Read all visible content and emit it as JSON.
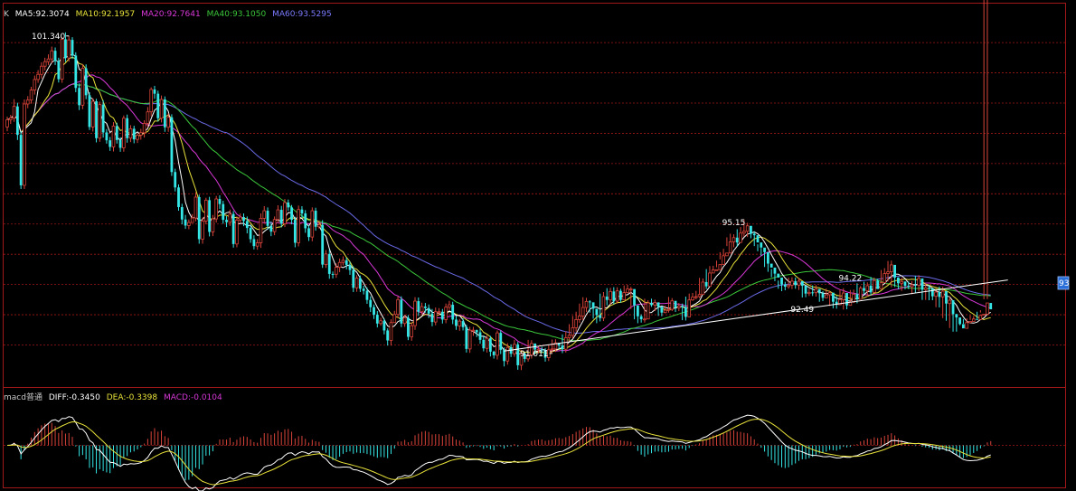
{
  "legend": {
    "k_label": "K",
    "ma5": "MA5:92.3074",
    "ma10": "MA10:92.1957",
    "ma20": "MA20:92.7641",
    "ma40": "MA40:93.1050",
    "ma60": "MA60:93.5295"
  },
  "macd_legend": {
    "name": "macd普通",
    "diff": "DIFF:-0.3450",
    "dea": "DEA:-0.3398",
    "macd": "MACD:-0.0104"
  },
  "colors": {
    "background": "#000000",
    "up_candle": "#d9443a",
    "down_candle": "#35e6e6",
    "ma5": "#ffffff",
    "ma10": "#e8e23a",
    "ma20": "#d838d8",
    "ma40": "#3ac63a",
    "ma60": "#6a6ae8",
    "grid": "#a01818",
    "trendline": "#ffffff",
    "price_tag": "#2a6fd8"
  },
  "chart_data": {
    "type": "candlestick",
    "grid": "horizontal dashed",
    "price_tag": "93",
    "annotations": [
      {
        "label": "101.340",
        "kind": "high",
        "bar": 18
      },
      {
        "label": "95.15",
        "kind": "high",
        "bar": 212
      },
      {
        "label": "94.22",
        "kind": "high",
        "bar": 246
      },
      {
        "label": "92.49",
        "kind": "low",
        "bar": 232
      },
      {
        "label": "91.011",
        "kind": "low",
        "bar": 159
      }
    ],
    "trendline": {
      "from_bar": 145,
      "from_value": 90.8,
      "to_bar": 292,
      "to_value": 93.15
    },
    "closes": [
      98.45,
      98.51,
      98.89,
      97.95,
      96.28,
      98.97,
      99.1,
      99.43,
      99.78,
      99.95,
      100.22,
      100.37,
      100.46,
      100.73,
      100.39,
      99.79,
      101.11,
      100.49,
      101.09,
      100.57,
      99.5,
      98.93,
      100.15,
      99.26,
      98.21,
      99.06,
      97.84,
      98.95,
      98.03,
      97.77,
      97.55,
      98.24,
      97.78,
      97.52,
      98.5,
      97.84,
      98.15,
      97.8,
      97.94,
      98.02,
      98.33,
      98.71,
      99.45,
      99.31,
      98.5,
      99.12,
      98.2,
      98.53,
      96.72,
      96.21,
      95.56,
      95.15,
      94.95,
      95.05,
      95.2,
      95.89,
      94.5,
      95.1,
      95.79,
      94.74,
      95.17,
      95.83,
      95.66,
      95.14,
      95.06,
      95.33,
      94.34,
      95.13,
      95.23,
      95.1,
      94.87,
      94.5,
      94.27,
      94.38,
      95.19,
      95.44,
      94.94,
      94.75,
      95.15,
      95.47,
      95.01,
      95.71,
      95.55,
      95.14,
      94.38,
      95.48,
      95.35,
      94.86,
      94.57,
      95.44,
      94.91,
      94.97,
      93.66,
      94.01,
      93.35,
      93.34,
      93.57,
      93.73,
      93.8,
      93.65,
      93.48,
      92.89,
      93.21,
      92.86,
      92.79,
      92.49,
      92.25,
      92.0,
      91.71,
      91.8,
      91.48,
      91.15,
      91.74,
      92.01,
      92.5,
      91.71,
      91.9,
      91.27,
      91.64,
      92.45,
      92.1,
      92.27,
      92.22,
      92.04,
      91.76,
      92.1,
      92.1,
      91.84,
      92.25,
      92.33,
      91.84,
      91.63,
      91.79,
      91.59,
      90.87,
      91.49,
      91.49,
      91.42,
      91.17,
      90.89,
      91.22,
      90.78,
      90.66,
      91.4,
      90.84,
      90.47,
      90.92,
      90.71,
      91.02,
      90.33,
      90.72,
      90.54,
      90.67,
      91.05,
      90.85,
      90.86,
      90.83,
      90.58,
      90.84,
      90.87,
      91.07,
      90.98,
      90.86,
      91.24,
      91.32,
      91.57,
      91.84,
      91.96,
      92.24,
      92.44,
      92.41,
      92.2,
      91.99,
      91.89,
      92.6,
      92.49,
      92.77,
      92.45,
      92.79,
      92.49,
      92.73,
      92.85,
      92.85,
      92.31,
      91.95,
      91.85,
      91.86,
      92.39,
      92.32,
      92.41,
      92.26,
      92.07,
      92.15,
      92.18,
      92.46,
      92.23,
      92.28,
      92.25,
      91.93,
      92.49,
      92.58,
      92.6,
      92.67,
      93.08,
      92.94,
      93.38,
      93.48,
      93.49,
      93.66,
      93.95,
      94.04,
      94.41,
      94.55,
      94.39,
      94.7,
      94.76,
      94.94,
      94.68,
      94.63,
      94.39,
      94.22,
      94.07,
      93.69,
      93.56,
      93.36,
      93.23,
      93.0,
      92.93,
      92.98,
      93.11,
      92.98,
      93.11,
      92.96,
      92.7,
      92.74,
      92.73,
      92.85,
      92.71,
      92.56,
      92.66,
      92.73,
      92.43,
      92.33,
      92.5,
      92.72,
      92.31,
      92.42,
      92.68,
      92.51,
      92.88,
      92.79,
      92.96,
      92.74,
      93.13,
      92.85,
      93.06,
      93.36,
      93.42,
      93.65,
      93.23,
      93.04,
      93.1,
      92.96,
      92.93,
      92.99,
      92.97,
      93.2,
      92.83,
      92.89,
      92.87,
      92.61,
      92.75,
      92.59,
      92.78,
      92.37,
      92.48,
      92.02,
      91.91,
      91.69,
      91.55,
      91.74,
      91.78,
      91.86,
      91.84,
      91.98,
      92.02,
      92.39,
      92.18
    ],
    "opens": [
      98.21,
      98.45,
      98.51,
      98.89,
      97.95,
      96.28,
      98.97,
      99.1,
      99.43,
      99.78,
      99.95,
      100.22,
      100.37,
      100.46,
      100.73,
      100.39,
      99.79,
      101.11,
      100.49,
      101.09,
      100.57,
      99.5,
      98.93,
      100.15,
      99.26,
      98.21,
      99.06,
      97.84,
      98.95,
      98.03,
      97.77,
      97.55,
      98.24,
      97.78,
      97.52,
      98.5,
      97.84,
      98.15,
      97.8,
      97.94,
      98.02,
      98.33,
      98.71,
      99.45,
      99.31,
      98.5,
      99.12,
      98.2,
      98.53,
      96.72,
      96.21,
      95.56,
      95.15,
      94.95,
      95.05,
      95.2,
      95.89,
      94.5,
      95.1,
      95.79,
      94.74,
      95.17,
      95.83,
      95.66,
      95.14,
      95.06,
      95.33,
      94.34,
      95.13,
      95.23,
      95.1,
      94.87,
      94.5,
      94.27,
      94.38,
      95.19,
      95.44,
      94.94,
      94.75,
      95.15,
      95.47,
      95.01,
      95.71,
      95.55,
      95.14,
      94.38,
      95.48,
      95.35,
      94.86,
      94.57,
      95.44,
      94.91,
      94.97,
      93.66,
      94.01,
      93.35,
      93.34,
      93.57,
      93.73,
      93.8,
      93.65,
      93.48,
      92.89,
      93.21,
      92.86,
      92.79,
      92.49,
      92.25,
      92.0,
      91.71,
      91.8,
      91.48,
      91.15,
      91.74,
      92.01,
      92.5,
      91.71,
      91.9,
      91.27,
      91.64,
      92.45,
      92.1,
      92.27,
      92.22,
      92.04,
      91.76,
      92.1,
      92.1,
      91.84,
      92.25,
      92.33,
      91.84,
      91.63,
      91.79,
      91.59,
      90.87,
      91.49,
      91.49,
      91.42,
      91.17,
      90.89,
      91.22,
      90.78,
      90.66,
      91.4,
      90.84,
      90.47,
      90.92,
      90.71,
      91.02,
      90.33,
      90.72,
      90.54,
      90.67,
      91.05,
      90.85,
      90.86,
      90.83,
      90.58,
      90.84,
      90.87,
      91.07,
      90.98,
      90.86,
      91.24,
      91.32,
      91.57,
      91.84,
      91.96,
      92.24,
      92.44,
      92.41,
      92.2,
      91.99,
      91.89,
      92.6,
      92.49,
      92.77,
      92.45,
      92.79,
      92.49,
      92.73,
      92.85,
      92.85,
      92.31,
      91.95,
      91.85,
      91.86,
      92.39,
      92.32,
      92.41,
      92.26,
      92.07,
      92.15,
      92.18,
      92.46,
      92.23,
      92.28,
      92.25,
      91.93,
      92.49,
      92.58,
      92.6,
      92.67,
      93.08,
      92.94,
      93.38,
      93.48,
      93.49,
      93.66,
      93.95,
      94.04,
      94.41,
      94.55,
      94.39,
      94.7,
      94.76,
      94.94,
      94.68,
      94.63,
      94.39,
      94.22,
      94.07,
      93.69,
      93.56,
      93.36,
      93.23,
      93.0,
      92.93,
      92.98,
      93.11,
      92.98,
      93.11,
      92.96,
      92.7,
      92.74,
      92.73,
      92.85,
      92.71,
      92.56,
      92.66,
      92.73,
      92.43,
      92.33,
      92.5,
      92.72,
      92.31,
      92.42,
      92.68,
      92.51,
      92.88,
      92.79,
      92.96,
      92.74,
      93.13,
      92.85,
      93.06,
      93.36,
      93.42,
      93.65,
      93.23,
      93.04,
      93.1,
      92.96,
      92.93,
      92.99,
      92.97,
      93.2,
      92.83,
      92.89,
      92.87,
      92.61,
      92.75,
      92.59,
      92.78,
      92.37,
      92.48,
      92.02,
      91.91,
      91.69,
      91.55,
      91.74,
      91.78,
      91.86,
      91.84,
      91.98,
      92.02,
      92.39
    ],
    "highs": [
      98.55,
      98.61,
      99.13,
      99.01,
      98.07,
      99.12,
      99.23,
      99.54,
      99.91,
      100.09,
      100.35,
      100.5,
      100.61,
      100.87,
      100.84,
      100.5,
      101.18,
      101.34,
      101.22,
      101.18,
      100.68,
      99.65,
      100.29,
      100.28,
      99.36,
      99.16,
      99.14,
      99.05,
      99.1,
      98.14,
      97.88,
      98.37,
      98.35,
      97.87,
      98.59,
      98.62,
      98.27,
      98.25,
      97.99,
      98.15,
      98.43,
      98.87,
      99.52,
      99.57,
      99.41,
      99.25,
      99.22,
      98.66,
      98.63,
      96.83,
      96.31,
      95.67,
      95.3,
      95.15,
      95.33,
      96.05,
      95.97,
      95.22,
      95.87,
      95.9,
      95.3,
      95.93,
      95.95,
      95.77,
      95.26,
      95.48,
      95.43,
      95.25,
      95.35,
      95.35,
      95.25,
      94.98,
      94.63,
      94.5,
      95.35,
      95.59,
      95.55,
      95.09,
      95.25,
      95.62,
      95.6,
      95.83,
      95.81,
      95.63,
      95.24,
      95.61,
      95.59,
      95.46,
      94.97,
      95.55,
      95.54,
      95.12,
      95.13,
      94.14,
      94.15,
      93.43,
      93.7,
      93.86,
      93.93,
      93.89,
      93.75,
      93.6,
      93.31,
      93.3,
      92.96,
      92.9,
      92.61,
      92.34,
      92.12,
      91.9,
      91.87,
      91.55,
      91.85,
      92.13,
      92.61,
      92.61,
      92.0,
      91.99,
      91.75,
      92.58,
      92.57,
      92.4,
      92.39,
      92.34,
      92.19,
      92.24,
      92.22,
      92.19,
      92.37,
      92.46,
      92.43,
      91.97,
      91.86,
      91.88,
      91.67,
      91.6,
      91.6,
      91.51,
      91.54,
      91.29,
      91.32,
      91.3,
      90.81,
      91.48,
      91.48,
      90.92,
      91.06,
      91.02,
      91.17,
      91.1,
      90.84,
      90.75,
      91.17,
      91.16,
      90.96,
      90.96,
      90.94,
      90.9,
      91.0,
      91.18,
      91.19,
      91.04,
      91.35,
      91.45,
      91.69,
      91.96,
      92.1,
      92.37,
      92.58,
      92.56,
      92.48,
      92.33,
      92.05,
      92.7,
      92.75,
      92.88,
      92.89,
      92.91,
      92.91,
      92.86,
      92.97,
      92.99,
      92.92,
      92.4,
      92.01,
      92.01,
      92.53,
      92.48,
      92.53,
      92.5,
      92.38,
      92.28,
      92.3,
      92.59,
      92.55,
      92.41,
      92.39,
      92.37,
      92.6,
      92.7,
      92.72,
      92.79,
      93.22,
      93.2,
      93.51,
      93.61,
      93.62,
      93.79,
      94.07,
      94.18,
      94.56,
      94.68,
      94.66,
      94.83,
      94.9,
      95.15,
      95.04,
      94.77,
      94.76,
      94.33,
      94.21,
      94.16,
      93.82,
      93.51,
      93.46,
      93.13,
      93.05,
      93.09,
      93.23,
      93.24,
      93.23,
      93.22,
      92.97,
      92.85,
      92.86,
      92.97,
      92.98,
      92.81,
      92.78,
      92.87,
      92.8,
      92.52,
      92.62,
      92.84,
      92.88,
      92.55,
      92.82,
      92.83,
      93.04,
      92.95,
      93.09,
      93.07,
      93.25,
      93.23,
      93.19,
      93.48,
      93.54,
      93.78,
      93.79,
      93.35,
      93.24,
      93.23,
      93.06,
      93.1,
      93.11,
      93.29,
      93.31,
      92.99,
      93.04,
      92.99,
      92.88,
      92.88,
      92.93,
      92.93,
      92.62,
      92.61,
      92.16,
      92.03,
      91.86,
      91.86,
      91.88,
      91.98,
      91.96,
      92.1,
      92.15,
      92.51,
      92.52
    ],
    "lows": [
      98.07,
      98.31,
      98.38,
      97.78,
      96.16,
      96.16,
      98.83,
      98.98,
      99.28,
      99.67,
      99.81,
      100.08,
      100.26,
      100.32,
      100.26,
      99.68,
      99.67,
      100.36,
      100.37,
      100.46,
      99.36,
      98.77,
      98.8,
      99.13,
      98.11,
      98.06,
      97.7,
      97.72,
      97.86,
      97.66,
      97.42,
      97.4,
      97.66,
      97.39,
      97.39,
      97.69,
      97.71,
      97.67,
      97.68,
      97.79,
      97.86,
      98.21,
      98.56,
      99.14,
      98.39,
      98.36,
      98.05,
      98.05,
      96.59,
      96.08,
      95.44,
      94.99,
      94.84,
      94.83,
      95.07,
      95.09,
      94.35,
      94.35,
      94.99,
      94.59,
      94.6,
      95.05,
      95.5,
      95.01,
      94.9,
      94.94,
      94.22,
      94.23,
      95.04,
      94.93,
      94.69,
      94.38,
      94.16,
      94.15,
      94.21,
      95.03,
      94.81,
      94.6,
      94.63,
      95.04,
      94.89,
      94.9,
      95.44,
      94.99,
      94.23,
      94.26,
      95.21,
      94.71,
      94.44,
      94.43,
      94.78,
      94.85,
      93.55,
      93.55,
      93.19,
      93.2,
      93.22,
      93.41,
      93.63,
      93.5,
      93.32,
      92.75,
      92.76,
      92.75,
      92.67,
      92.36,
      92.09,
      91.86,
      91.58,
      91.64,
      91.35,
      90.98,
      90.98,
      91.9,
      91.89,
      91.59,
      91.6,
      91.16,
      91.14,
      91.5,
      91.96,
      92.0,
      92.07,
      91.89,
      91.62,
      91.65,
      91.97,
      91.71,
      91.72,
      92.16,
      91.69,
      91.5,
      91.47,
      91.48,
      90.75,
      90.74,
      91.3,
      91.26,
      91.04,
      90.79,
      90.75,
      90.62,
      90.55,
      90.52,
      90.7,
      90.29,
      90.35,
      90.6,
      90.61,
      90.18,
      90.17,
      90.43,
      90.45,
      90.55,
      90.69,
      90.72,
      90.74,
      90.45,
      90.47,
      90.72,
      90.77,
      90.86,
      90.73,
      90.75,
      91.12,
      91.22,
      91.44,
      91.73,
      91.82,
      92.09,
      92.07,
      91.87,
      91.72,
      91.78,
      91.79,
      92.31,
      92.34,
      92.35,
      92.37,
      92.4,
      92.58,
      92.71,
      92.19,
      91.85,
      91.72,
      91.74,
      91.74,
      92.2,
      92.26,
      92.12,
      91.96,
      91.95,
      92.05,
      92.07,
      92.12,
      92.09,
      92.12,
      91.82,
      91.81,
      92.43,
      92.46,
      92.51,
      92.55,
      92.82,
      92.85,
      93.27,
      93.38,
      93.57,
      93.83,
      93.95,
      94.27,
      94.27,
      94.23,
      94.25,
      94.63,
      94.58,
      94.57,
      94.53,
      94.27,
      94.1,
      93.95,
      93.58,
      93.42,
      93.24,
      93.11,
      92.86,
      92.78,
      92.81,
      92.86,
      92.85,
      92.86,
      92.82,
      92.57,
      92.58,
      92.62,
      92.62,
      92.6,
      92.43,
      92.45,
      92.57,
      92.29,
      92.21,
      92.2,
      92.38,
      92.17,
      92.18,
      92.31,
      92.39,
      92.38,
      92.67,
      92.67,
      92.6,
      92.64,
      92.72,
      92.89,
      92.94,
      93.24,
      93.1,
      92.91,
      92.92,
      92.84,
      92.79,
      92.84,
      92.85,
      92.68,
      92.71,
      92.77,
      92.49,
      92.49,
      92.48,
      92.48,
      92.25,
      92.24,
      91.89,
      91.8,
      91.56,
      91.44,
      91.44,
      91.65,
      91.7,
      91.73,
      91.83,
      91.86,
      91.87,
      92.07
    ],
    "macd_diff_range": [
      -0.9,
      0.9
    ]
  }
}
